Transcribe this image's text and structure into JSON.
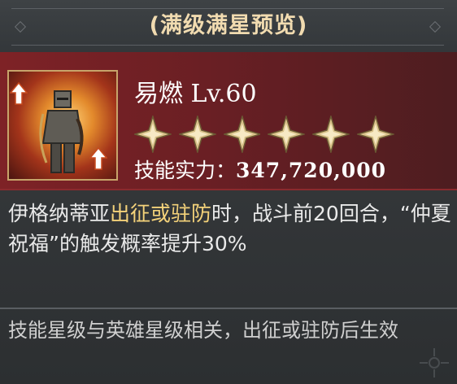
{
  "header": {
    "title": "(满级满星预览)"
  },
  "skill": {
    "name": "易燃",
    "level": "Lv.60",
    "star_count": 6,
    "power_label": "技能实力：",
    "power_value": "347,720,000",
    "portrait_icon": "armored-knight-portrait",
    "boost_icon": "up-arrow-icon"
  },
  "description": {
    "part1": "伊格纳蒂亚",
    "highlight": "出征或驻防",
    "part2": "时，战斗前20回合，“仲夏祝福”的触发概率提升30%"
  },
  "note": {
    "text": "技能星级与英雄星级相关，出征或驻防后生效"
  },
  "colors": {
    "title": "#f1dbb0",
    "highlight": "#f4d27a",
    "band": "#7e2226",
    "star": "#d9c28a"
  }
}
